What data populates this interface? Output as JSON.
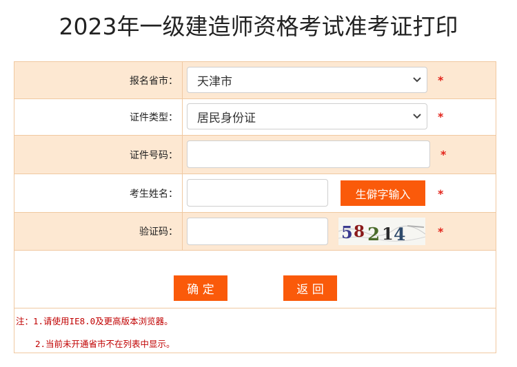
{
  "page": {
    "title": "2023年一级建造师资格考试准考证打印"
  },
  "form": {
    "province": {
      "label": "报名省市：",
      "selected": "天津市"
    },
    "id_type": {
      "label": "证件类型：",
      "selected": "居民身份证"
    },
    "id_number": {
      "label": "证件号码：",
      "value": ""
    },
    "name": {
      "label": "考生姓名：",
      "value": "",
      "rare_char_button": "生僻字输入"
    },
    "captcha": {
      "label": "验证码：",
      "value": "",
      "image_text": "58214"
    },
    "required_mark": "*",
    "confirm_button": "确 定",
    "back_button": "返 回"
  },
  "notes": {
    "line1": "注：1.请使用IE8.0及更高版本浏览器。",
    "line2": "2.当前未开通省市不在列表中显示。"
  },
  "colors": {
    "row_shade": "#fde8d2",
    "border": "#f0c8a0",
    "button": "#fa5a0a",
    "required": "#e2231a",
    "note_text": "#c00000"
  },
  "icons": {
    "dropdown": "chevron-down-icon"
  }
}
